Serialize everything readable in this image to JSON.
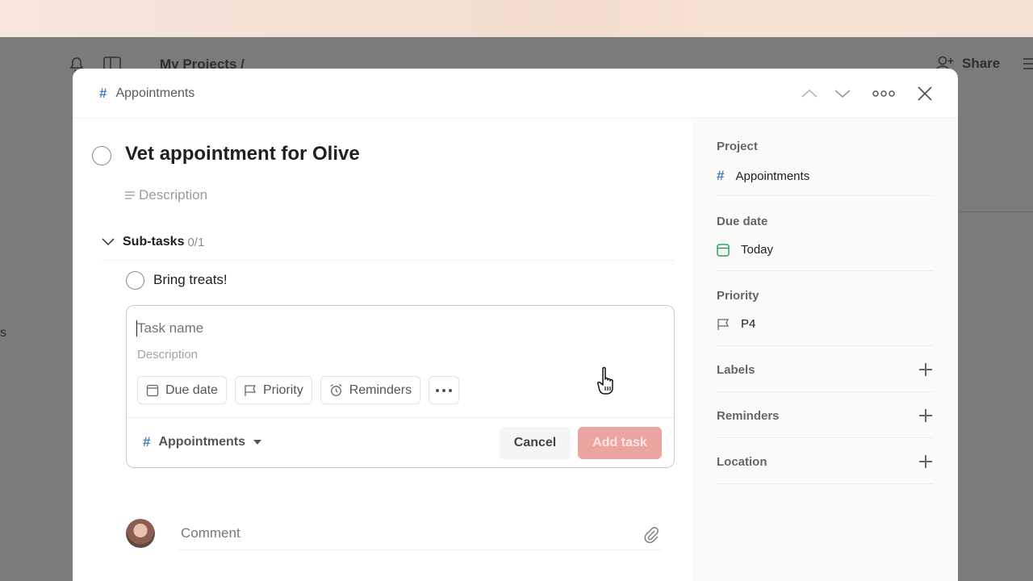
{
  "background": {
    "breadcrumb": "My Projects  /",
    "share_label": "Share",
    "edge_letter": "s"
  },
  "modal": {
    "header": {
      "project_name": "Appointments"
    },
    "task": {
      "title": "Vet appointment for Olive",
      "description_placeholder": "Description"
    },
    "subtasks": {
      "title": "Sub-tasks",
      "count": "0/1",
      "items": [
        {
          "label": "Bring treats!"
        }
      ]
    },
    "editor": {
      "name_placeholder": "Task name",
      "description_placeholder": "Description",
      "chips": {
        "due_date": "Due date",
        "priority": "Priority",
        "reminders": "Reminders"
      },
      "project": "Appointments",
      "cancel_label": "Cancel",
      "add_label": "Add task"
    },
    "comment": {
      "placeholder": "Comment"
    },
    "sidebar": {
      "project": {
        "label": "Project",
        "value": "Appointments"
      },
      "due_date": {
        "label": "Due date",
        "value": "Today"
      },
      "priority": {
        "label": "Priority",
        "value": "P4"
      },
      "labels": {
        "label": "Labels"
      },
      "reminders": {
        "label": "Reminders"
      },
      "location": {
        "label": "Location"
      }
    }
  },
  "colors": {
    "accent_project": "#4c7dbf",
    "due_today": "#25a35a",
    "add_button": "#eba4a0"
  }
}
